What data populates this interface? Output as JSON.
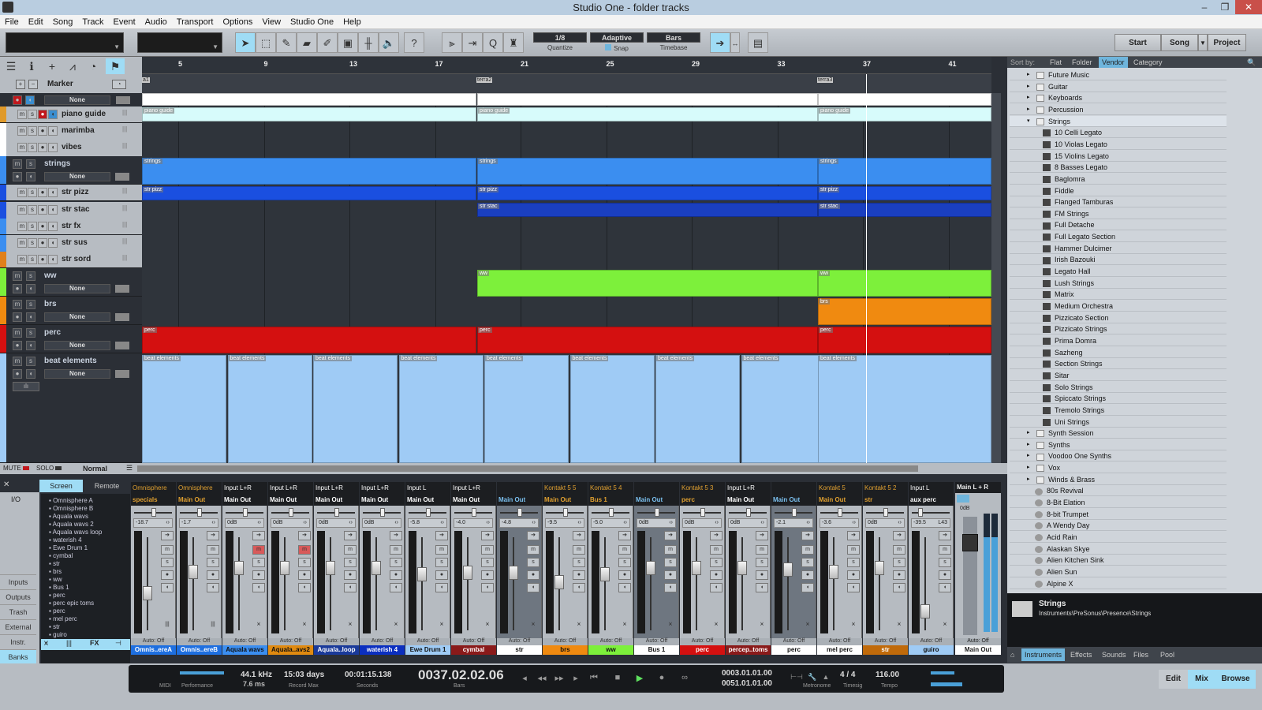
{
  "window": {
    "title": "Studio One - folder tracks",
    "icon": "studio-one-logo-icon",
    "controls": [
      "minimize-icon",
      "restore-icon",
      "close-icon"
    ]
  },
  "menu": [
    "File",
    "Edit",
    "Song",
    "Track",
    "Event",
    "Audio",
    "Transport",
    "Options",
    "View",
    "Studio One",
    "Help"
  ],
  "toolbar": {
    "tools": [
      "arrow-tool-icon",
      "range-tool-icon",
      "split-tool-icon",
      "eraser-tool-icon",
      "paint-tool-icon",
      "mute-tool-icon",
      "bend-tool-icon",
      "listen-tool-icon",
      "help-icon"
    ],
    "edit_tools": [
      "groove-icon",
      "split-icon",
      "quantize-icon",
      "metronome-icon"
    ],
    "quantize": {
      "value": "1/8",
      "label": "Quantize"
    },
    "snap": {
      "value": "Adaptive",
      "label": "Snap"
    },
    "timebase": {
      "value": "Bars",
      "label": "Timebase"
    },
    "start_label": "Start",
    "song_label": "Song",
    "project_label": "Project"
  },
  "track_tools": [
    "menu-icon",
    "info-icon",
    "add-icon",
    "automation-icon",
    "clock-icon",
    "marker-flag-icon"
  ],
  "marker": {
    "label": "Marker",
    "add": "+",
    "remove": "−",
    "none": "None",
    "markers": [
      "a1",
      "terra2",
      "terra3"
    ]
  },
  "ruler": [
    "5",
    "9",
    "13",
    "17",
    "21",
    "25",
    "29",
    "33",
    "37",
    "41"
  ],
  "tracks": [
    {
      "name": "piano guide",
      "type": "inner",
      "color": "#e09a2a"
    },
    {
      "name": "marimba",
      "type": "inner",
      "color": "#ffffff"
    },
    {
      "name": "vibes",
      "type": "inner",
      "color": "#ffffff"
    },
    {
      "name": "strings",
      "type": "folder",
      "color": "#3b8ef0",
      "none": "None"
    },
    {
      "name": "str pizz",
      "type": "inner",
      "color": "#1a4fe0"
    },
    {
      "name": "str stac",
      "type": "inner",
      "color": "#1a4fe0"
    },
    {
      "name": "str fx",
      "type": "inner",
      "color": "#3b8ef0"
    },
    {
      "name": "str sus",
      "type": "inner",
      "color": "#3b8ef0"
    },
    {
      "name": "str sord",
      "type": "inner",
      "color": "#e0801a"
    },
    {
      "name": "ww",
      "type": "folder",
      "color": "#7df03b",
      "none": "None"
    },
    {
      "name": "brs",
      "type": "folder",
      "color": "#f08a10",
      "none": "None"
    },
    {
      "name": "perc",
      "type": "folder",
      "color": "#d41010",
      "none": "None"
    },
    {
      "name": "beat elements",
      "type": "folder",
      "color": "#9fcbf5",
      "none": "None"
    }
  ],
  "events": {
    "piano": "piano guide",
    "strings": "strings",
    "pizz": "str pizz",
    "stac": "str stac",
    "ww": "ww",
    "brs": "brs",
    "perc": "perc",
    "beat": "beat elements"
  },
  "console": {
    "mute": "MUTE",
    "solo": "SOLO",
    "mode": "Normal",
    "tabs": [
      "Screen",
      "Remote"
    ],
    "io": "I/O",
    "left_buttons": [
      "Inputs",
      "Outputs",
      "Trash",
      "External",
      "Instr.",
      "Banks"
    ],
    "list": [
      "Omnisphere A",
      "Omnisphere B",
      "Aquala wavs",
      "Aquala wavs 2",
      "Aquala wavs loop",
      "waterish 4",
      "Ewe Drum 1",
      "cymbal",
      "str",
      "brs",
      "ww",
      "Bus 1",
      "perc",
      "perc epic toms",
      "perc",
      "mel perc",
      "str",
      "guiro"
    ],
    "bottom_tabs": [
      "mixer-icon",
      "meter-icon",
      "FX",
      "bus-icon"
    ],
    "channels": [
      {
        "input": "Omnisphere",
        "output": "specials",
        "vol": "-18.7",
        "name": "Omnis..ereA",
        "namecolor": "#1e6fe0",
        "textcolor": "#fff",
        "io_color": "#e0a030",
        "dark": false,
        "fader": 0.62,
        "mute": false
      },
      {
        "input": "Omnisphere",
        "output": "Main Out",
        "vol": "-1.7",
        "name": "Omnis..ereB",
        "namecolor": "#1e6fe0",
        "textcolor": "#fff",
        "io_color": "#e0a030",
        "dark": false,
        "fader": 0.35,
        "mute": false
      },
      {
        "input": "Input L+R",
        "output": "Main Out",
        "vol": "0dB",
        "name": "Aquala wavs",
        "namecolor": "#3b8ef0",
        "textcolor": "#111",
        "io_color": "#fff",
        "dark": false,
        "fader": 0.3,
        "mute": true
      },
      {
        "input": "Input L+R",
        "output": "Main Out",
        "vol": "0dB",
        "name": "Aquala..avs2",
        "namecolor": "#e08a10",
        "textcolor": "#111",
        "io_color": "#fff",
        "dark": false,
        "fader": 0.3,
        "mute": true
      },
      {
        "input": "Input L+R",
        "output": "Main Out",
        "vol": "0dB",
        "name": "Aquala..loop",
        "namecolor": "#1a3a9a",
        "textcolor": "#fff",
        "io_color": "#fff",
        "dark": false,
        "fader": 0.3,
        "mute": false
      },
      {
        "input": "Input L+R",
        "output": "Main Out",
        "vol": "0dB",
        "name": "waterish 4",
        "namecolor": "#0b2fc0",
        "textcolor": "#fff",
        "io_color": "#fff",
        "dark": false,
        "fader": 0.3,
        "mute": false
      },
      {
        "input": "Input L",
        "output": "Main Out",
        "vol": "-5.8",
        "name": "Ewe Drum 1",
        "namecolor": "#9fcbf5",
        "textcolor": "#111",
        "io_color": "#fff",
        "dark": false,
        "fader": 0.38,
        "mute": false
      },
      {
        "input": "Input L+R",
        "output": "Main Out",
        "vol": "-4.0",
        "name": "cymbal",
        "namecolor": "#8a1a1a",
        "textcolor": "#fff",
        "io_color": "#fff",
        "dark": false,
        "fader": 0.36,
        "mute": false
      },
      {
        "input": "",
        "output": "Main Out",
        "vol": "-4.8",
        "name": "str",
        "namecolor": "#ffffff",
        "textcolor": "#111",
        "io_color": "#7bc0ef",
        "dark": true,
        "fader": 0.36,
        "mute": false
      },
      {
        "input": "Kontakt 5 5",
        "output": "Main Out",
        "vol": "-9.5",
        "name": "brs",
        "namecolor": "#f08a10",
        "textcolor": "#111",
        "io_color": "#e0a030",
        "dark": false,
        "fader": 0.48,
        "mute": false
      },
      {
        "input": "Kontakt 5 4",
        "output": "Bus 1",
        "vol": "-5.0",
        "name": "ww",
        "namecolor": "#7df03b",
        "textcolor": "#111",
        "io_color": "#e0a030",
        "dark": false,
        "fader": 0.38,
        "mute": false
      },
      {
        "input": "",
        "output": "Main Out",
        "vol": "0dB",
        "name": "Bus 1",
        "namecolor": "#ffffff",
        "textcolor": "#111",
        "io_color": "#7bc0ef",
        "dark": true,
        "fader": 0.3,
        "mute": false
      },
      {
        "input": "Kontakt 5 3",
        "output": "perc",
        "vol": "0dB",
        "name": "perc",
        "namecolor": "#d41010",
        "textcolor": "#fff",
        "io_color": "#e0a030",
        "dark": false,
        "fader": 0.3,
        "mute": false
      },
      {
        "input": "Input L+R",
        "output": "Main Out",
        "vol": "0dB",
        "name": "percep..toms",
        "namecolor": "#8a1a1a",
        "textcolor": "#fff",
        "io_color": "#fff",
        "dark": false,
        "fader": 0.3,
        "mute": false
      },
      {
        "input": "",
        "output": "Main Out",
        "vol": "-2.1",
        "name": "perc",
        "namecolor": "#ffffff",
        "textcolor": "#111",
        "io_color": "#7bc0ef",
        "dark": true,
        "fader": 0.32,
        "mute": false
      },
      {
        "input": "Kontakt 5",
        "output": "Main Out",
        "vol": "-3.6",
        "name": "mel perc",
        "namecolor": "#ffffff",
        "textcolor": "#111",
        "io_color": "#e0a030",
        "dark": false,
        "fader": 0.35,
        "mute": false
      },
      {
        "input": "Kontakt 5 2",
        "output": "str",
        "vol": "0dB",
        "name": "str",
        "namecolor": "#c06a0a",
        "textcolor": "#fff",
        "io_color": "#e0a030",
        "dark": false,
        "fader": 0.3,
        "mute": false
      },
      {
        "input": "Input L",
        "output": "aux perc",
        "vol": "-39.5",
        "pan": "L43",
        "name": "guiro",
        "namecolor": "#9fcbf5",
        "textcolor": "#111",
        "io_color": "#fff",
        "dark": false,
        "fader": 0.85,
        "mute": false
      }
    ],
    "auto_label": "Auto: Off",
    "main": {
      "input": "Main L + R",
      "vol": "0dB",
      "name": "Main Out",
      "meter_scale": [
        "3",
        "0",
        "-3",
        "-6",
        "-9",
        "-12",
        "-24",
        "-36",
        "-48",
        "-60"
      ]
    }
  },
  "browser": {
    "sort_label": "Sort by:",
    "sort_tabs": [
      "Flat",
      "Folder",
      "Vendor",
      "Category"
    ],
    "sort_active": "Vendor",
    "items": [
      {
        "label": "Future Music",
        "kind": "folder"
      },
      {
        "label": "Guitar",
        "kind": "folder"
      },
      {
        "label": "Keyboards",
        "kind": "folder"
      },
      {
        "label": "Percussion",
        "kind": "folder"
      },
      {
        "label": "Strings",
        "kind": "folder-open"
      },
      {
        "label": "10 Celli Legato",
        "kind": "preset"
      },
      {
        "label": "10 Violas Legato",
        "kind": "preset"
      },
      {
        "label": "15 Violins Legato",
        "kind": "preset"
      },
      {
        "label": "8 Basses Legato",
        "kind": "preset"
      },
      {
        "label": "Baglomra",
        "kind": "preset"
      },
      {
        "label": "Fiddle",
        "kind": "preset"
      },
      {
        "label": "Flanged Tamburas",
        "kind": "preset"
      },
      {
        "label": "FM Strings",
        "kind": "preset"
      },
      {
        "label": "Full Detache",
        "kind": "preset"
      },
      {
        "label": "Full Legato Section",
        "kind": "preset"
      },
      {
        "label": "Hammer Dulcimer",
        "kind": "preset"
      },
      {
        "label": "Irish Bazouki",
        "kind": "preset"
      },
      {
        "label": "Legato Hall",
        "kind": "preset"
      },
      {
        "label": "Lush Strings",
        "kind": "preset"
      },
      {
        "label": "Matrix",
        "kind": "preset"
      },
      {
        "label": "Medium Orchestra",
        "kind": "preset"
      },
      {
        "label": "Pizzicato Section",
        "kind": "preset"
      },
      {
        "label": "Pizzicato Strings",
        "kind": "preset"
      },
      {
        "label": "Prima Domra",
        "kind": "preset"
      },
      {
        "label": "Sazheng",
        "kind": "preset"
      },
      {
        "label": "Section Strings",
        "kind": "preset"
      },
      {
        "label": "Sitar",
        "kind": "preset"
      },
      {
        "label": "Solo Strings",
        "kind": "preset"
      },
      {
        "label": "Spiccato Strings",
        "kind": "preset"
      },
      {
        "label": "Tremolo Strings",
        "kind": "preset"
      },
      {
        "label": "Uni Strings",
        "kind": "preset"
      },
      {
        "label": "Synth Session",
        "kind": "folder"
      },
      {
        "label": "Synths",
        "kind": "folder"
      },
      {
        "label": "Voodoo One Synths",
        "kind": "folder"
      },
      {
        "label": "Vox",
        "kind": "folder"
      },
      {
        "label": "Winds & Brass",
        "kind": "folder"
      },
      {
        "label": "80s Revival",
        "kind": "synth"
      },
      {
        "label": "8-Bit Elation",
        "kind": "synth"
      },
      {
        "label": "8-bit Trumpet",
        "kind": "synth"
      },
      {
        "label": "A Wendy Day",
        "kind": "synth"
      },
      {
        "label": "Acid Rain",
        "kind": "synth"
      },
      {
        "label": "Alaskan Skye",
        "kind": "synth"
      },
      {
        "label": "Alien Kitchen Sink",
        "kind": "synth"
      },
      {
        "label": "Alien Sun",
        "kind": "synth"
      },
      {
        "label": "Alpine X",
        "kind": "synth"
      }
    ],
    "info_title": "Strings",
    "info_path": "Instruments\\PreSonus\\Presence\\Strings",
    "tabs": [
      "Instruments",
      "Effects",
      "Sounds",
      "Files",
      "Pool"
    ],
    "tab_active": "Instruments"
  },
  "transport": {
    "midi_label": "MIDI",
    "performance_label": "Performance",
    "sample_rate": "44.1 kHz",
    "latency": "7.6 ms",
    "record_max": "15:03 days",
    "record_max_label": "Record Max",
    "seconds": "00:01:15.138",
    "seconds_label": "Seconds",
    "bars": "0037.02.02.06",
    "bars_label": "Bars",
    "loop_start": "0003.01.01.00",
    "loop_end": "0051.01.01.00",
    "metronome_label": "Metronome",
    "timesig": "4 / 4",
    "timesig_label": "Timesig",
    "tempo": "116.00",
    "tempo_label": "Tempo",
    "edit": "Edit",
    "mix": "Mix",
    "browse": "Browse"
  }
}
